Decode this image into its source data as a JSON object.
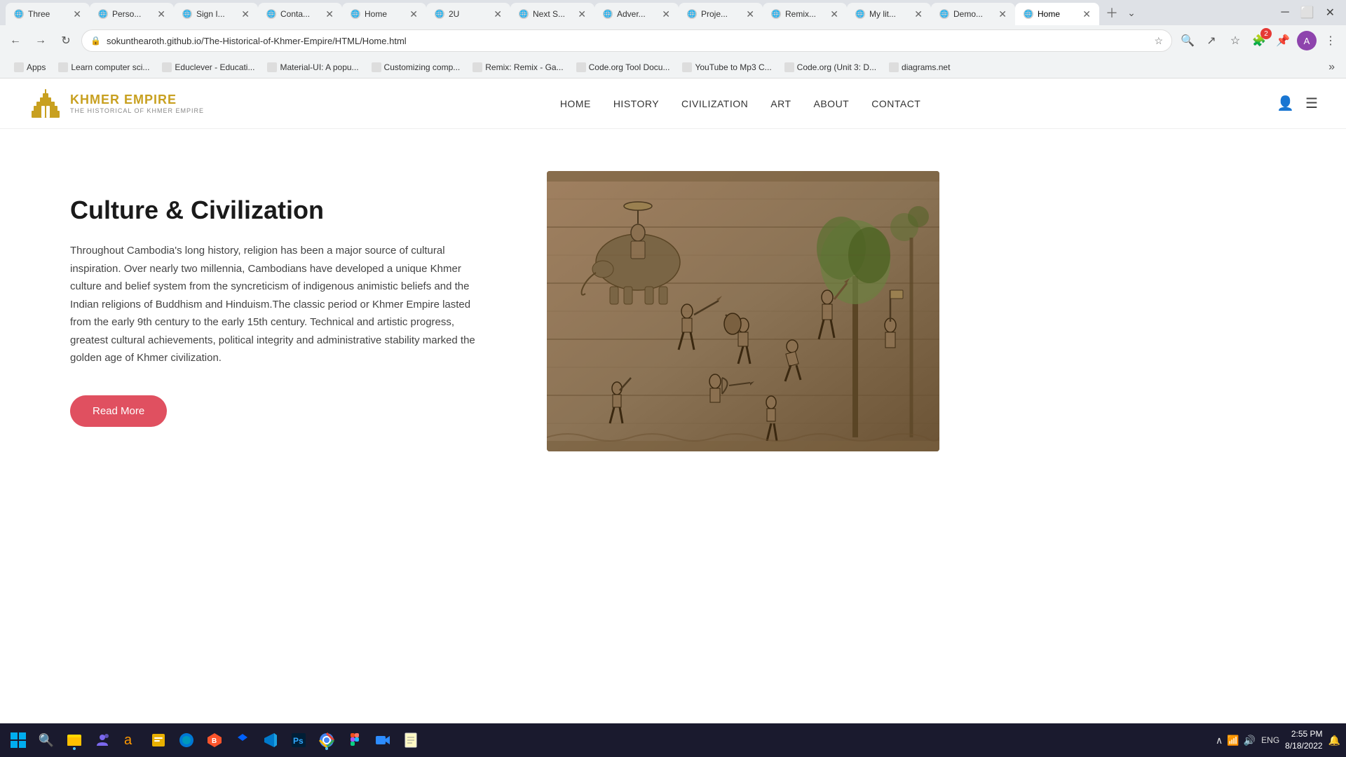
{
  "browser": {
    "tabs": [
      {
        "id": "three",
        "title": "Three",
        "active": false,
        "favicon": "🌐"
      },
      {
        "id": "perso",
        "title": "Perso...",
        "active": false,
        "favicon": "🌐"
      },
      {
        "id": "sign",
        "title": "Sign I...",
        "active": false,
        "favicon": "🌐"
      },
      {
        "id": "conta",
        "title": "Conta...",
        "active": false,
        "favicon": "🌐"
      },
      {
        "id": "home1",
        "title": "Home",
        "active": false,
        "favicon": "🌐"
      },
      {
        "id": "2u",
        "title": "2U",
        "active": false,
        "favicon": "🌐"
      },
      {
        "id": "nexts",
        "title": "Next S...",
        "active": false,
        "favicon": "🌐"
      },
      {
        "id": "adver",
        "title": "Adver...",
        "active": false,
        "favicon": "🌐"
      },
      {
        "id": "proje",
        "title": "Proje...",
        "active": false,
        "favicon": "🌐"
      },
      {
        "id": "remix",
        "title": "Remix...",
        "active": false,
        "favicon": "🌐"
      },
      {
        "id": "mylit",
        "title": "My lit...",
        "active": false,
        "favicon": "🌐"
      },
      {
        "id": "demo",
        "title": "Demo...",
        "active": false,
        "favicon": "🌐"
      },
      {
        "id": "home2",
        "title": "Home",
        "active": true,
        "favicon": "🌐"
      }
    ],
    "url": "sokunthearoth.github.io/The-Historical-of-Khmer-Empire/HTML/Home.html",
    "bookmarks": [
      {
        "label": "Apps",
        "icon": "⋮⋮"
      },
      {
        "label": "Learn computer sci...",
        "icon": "🌐"
      },
      {
        "label": "Educlever - Educati...",
        "icon": "🌐"
      },
      {
        "label": "Material-UI: A popu...",
        "icon": "🌐"
      },
      {
        "label": "Customizing comp...",
        "icon": "🌐"
      },
      {
        "label": "Remix: Remix - Ga...",
        "icon": "🌐"
      },
      {
        "label": "Code.org Tool Docu...",
        "icon": "🌐"
      },
      {
        "label": "YouTube to Mp3 C...",
        "icon": "🌐"
      },
      {
        "label": "Code.org (Unit 3: D...",
        "icon": "🌐"
      },
      {
        "label": "diagrams.net",
        "icon": "🌐"
      }
    ]
  },
  "site": {
    "logo": {
      "main_text": "KHMER EMPIRE",
      "sub_text": "THE HISTORICAL OF KHMER EMPIRE"
    },
    "nav": {
      "links": [
        "HOME",
        "HISTORY",
        "CIVILIZATION",
        "ART",
        "ABOUT",
        "CONTACT"
      ]
    },
    "section": {
      "title": "Culture & Civilization",
      "body": "Throughout Cambodia's long history, religion has been a major source of cultural inspiration. Over nearly two millennia, Cambodians have developed a unique Khmer culture and belief system from the syncreticism of indigenous animistic beliefs and the Indian religions of Buddhism and Hinduism.The classic period or Khmer Empire lasted from the early 9th century to the early 15th century. Technical and artistic progress, greatest cultural achievements, political integrity and administrative stability marked the golden age of Khmer civilization.",
      "read_more_label": "Read More"
    }
  },
  "taskbar": {
    "time": "2:55 PM",
    "date": "8/18/2022",
    "language": "ENG",
    "apps": [
      "⊞",
      "🔍",
      "📁",
      "💬",
      "🎵",
      "📦",
      "🗄️",
      "🔷",
      "🎨",
      "💻",
      "🔵",
      "📊",
      "📝"
    ]
  }
}
